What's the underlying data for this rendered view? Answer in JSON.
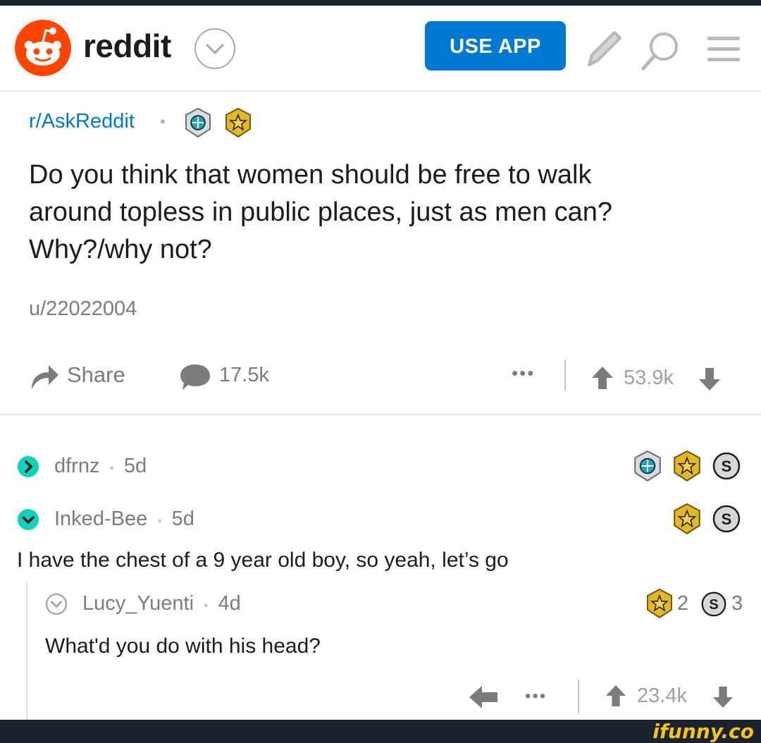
{
  "header": {
    "logo_text": "reddit",
    "use_app_label": "USE APP",
    "icons": [
      "reddit-alien-icon",
      "chevron-down-icon",
      "pencil-icon",
      "search-icon",
      "hamburger-menu-icon"
    ]
  },
  "post": {
    "subreddit": "r/AskReddit",
    "title_lines": [
      "Do you think that women should be free to walk",
      "around topless in public places, just as men can?",
      "Why?/why not?"
    ],
    "author": "u/22022004",
    "share_label": "Share",
    "comment_count": "17.5k",
    "vote_score": "53.9k"
  },
  "comments": [
    {
      "username": "dfrnz",
      "age": "5d",
      "collapsed": true,
      "awards": [
        "platinum-award-icon",
        "gold-award-icon",
        "silver-award-icon"
      ]
    },
    {
      "username": "Inked-Bee",
      "age": "5d",
      "body": "I have the chest of a 9 year old boy, so yeah, let’s go",
      "awards": [
        "gold-award-icon",
        "silver-award-icon"
      ]
    },
    {
      "username": "Lucy_Yuenti",
      "age": "4d",
      "body": "What'd you do with his head?",
      "gold_count": "2",
      "silver_count": "3",
      "vote_score": "23.4k"
    }
  ],
  "watermark": "ifunny.co",
  "colors": {
    "reddit_orange": "#ff4500",
    "reddit_blue": "#0079d3",
    "teal_expand": "#0dd3bb",
    "muted_text": "#7c7c7c"
  }
}
